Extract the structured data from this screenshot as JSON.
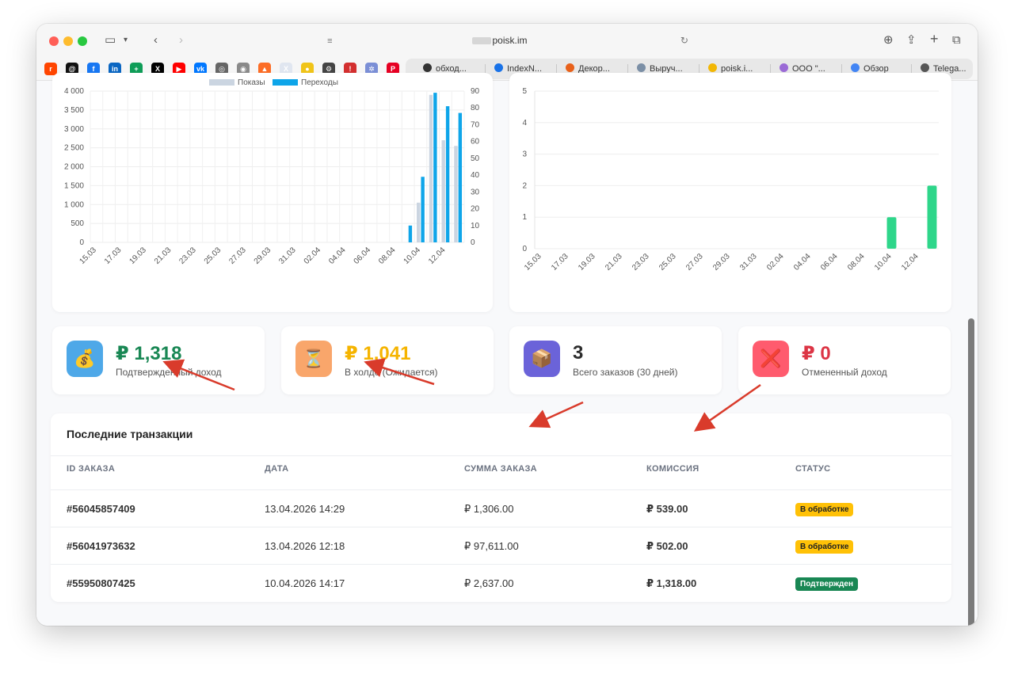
{
  "browser": {
    "url_domain": "poisk.im",
    "bookmark_tabs": [
      {
        "label": "обход...",
        "color": "#333333"
      },
      {
        "label": "IndexN...",
        "color": "#1a73e8"
      },
      {
        "label": "Декор...",
        "color": "#e8611a"
      },
      {
        "label": "Выруч...",
        "color": "#7b8fa6"
      },
      {
        "label": "poisk.i...",
        "color": "#f2b705"
      },
      {
        "label": "ООО \"...",
        "color": "#9b6bd6"
      },
      {
        "label": "Обзор",
        "color": "#4285f4"
      },
      {
        "label": "Telega...",
        "color": "#555555"
      }
    ],
    "favicons": [
      {
        "icon": "reddit-icon",
        "color": "#ff4500",
        "glyph": "r"
      },
      {
        "icon": "threads-icon",
        "color": "#111111",
        "glyph": "@"
      },
      {
        "icon": "facebook-icon",
        "color": "#1877f2",
        "glyph": "f"
      },
      {
        "icon": "linkedin-icon",
        "color": "#0a66c2",
        "glyph": "in"
      },
      {
        "icon": "sheets-icon",
        "color": "#0f9d58",
        "glyph": "+"
      },
      {
        "icon": "x-icon",
        "color": "#000000",
        "glyph": "X"
      },
      {
        "icon": "youtube-icon",
        "color": "#ff0000",
        "glyph": "▶"
      },
      {
        "icon": "vk-icon",
        "color": "#0077ff",
        "glyph": "vk"
      },
      {
        "icon": "globe-icon",
        "color": "#666666",
        "glyph": "◎"
      },
      {
        "icon": "compass-icon",
        "color": "#8a8a8a",
        "glyph": "◉"
      },
      {
        "icon": "gitlab-icon",
        "color": "#fc6d26",
        "glyph": "▲"
      },
      {
        "icon": "x-bookmark-icon",
        "color": "#e0e6f0",
        "glyph": "X"
      },
      {
        "icon": "bot-icon",
        "color": "#f0c419",
        "glyph": "●"
      },
      {
        "icon": "settings-icon",
        "color": "#444444",
        "glyph": "⚙"
      },
      {
        "icon": "alert-icon",
        "color": "#d32f2f",
        "glyph": "!"
      },
      {
        "icon": "network-icon",
        "color": "#7b8fd6",
        "glyph": "✲"
      },
      {
        "icon": "pinterest-icon",
        "color": "#e60023",
        "glyph": "P"
      }
    ]
  },
  "chart_data": [
    {
      "type": "bar",
      "legend": [
        "Показы",
        "Переходы"
      ],
      "categories": [
        "15.03",
        "16.03",
        "17.03",
        "18.03",
        "19.03",
        "20.03",
        "21.03",
        "22.03",
        "23.03",
        "24.03",
        "25.03",
        "26.03",
        "27.03",
        "28.03",
        "29.03",
        "30.03",
        "31.03",
        "01.04",
        "02.04",
        "03.04",
        "04.04",
        "05.04",
        "06.04",
        "07.04",
        "08.04",
        "09.04",
        "10.04",
        "11.04",
        "12.04",
        "13.04"
      ],
      "tick_labels": [
        "15.03",
        "17.03",
        "19.03",
        "21.03",
        "23.03",
        "25.03",
        "27.03",
        "29.03",
        "31.03",
        "02.04",
        "04.04",
        "06.04",
        "08.04",
        "10.04",
        "12.04"
      ],
      "series": [
        {
          "name": "Показы",
          "axis": "left",
          "color": "#cbd5e1",
          "values": [
            0,
            0,
            0,
            0,
            0,
            0,
            0,
            0,
            0,
            0,
            0,
            0,
            0,
            0,
            0,
            0,
            0,
            0,
            0,
            0,
            0,
            0,
            0,
            0,
            0,
            0,
            1050,
            3900,
            2700,
            2550
          ]
        },
        {
          "name": "Переходы",
          "axis": "right",
          "color": "#0ea5e9",
          "values": [
            0,
            0,
            0,
            0,
            0,
            0,
            0,
            0,
            0,
            0,
            0,
            0,
            0,
            0,
            0,
            0,
            0,
            0,
            0,
            0,
            0,
            0,
            0,
            0,
            0,
            10,
            39,
            89,
            81,
            77
          ]
        }
      ],
      "y_left": {
        "min": 0,
        "max": 4000,
        "ticks": [
          "0",
          "500",
          "1 000",
          "1 500",
          "2 000",
          "2 500",
          "3 000",
          "3 500",
          "4 000"
        ]
      },
      "y_right": {
        "min": 0,
        "max": 90,
        "ticks": [
          "0",
          "10",
          "20",
          "30",
          "40",
          "50",
          "60",
          "70",
          "80",
          "90"
        ]
      },
      "grid": true,
      "legend_position": "top"
    },
    {
      "type": "bar",
      "categories": [
        "15.03",
        "16.03",
        "17.03",
        "18.03",
        "19.03",
        "20.03",
        "21.03",
        "22.03",
        "23.03",
        "24.03",
        "25.03",
        "26.03",
        "27.03",
        "28.03",
        "29.03",
        "30.03",
        "31.03",
        "01.04",
        "02.04",
        "03.04",
        "04.04",
        "05.04",
        "06.04",
        "07.04",
        "08.04",
        "09.04",
        "10.04",
        "11.04",
        "12.04",
        "13.04"
      ],
      "tick_labels": [
        "15.03",
        "17.03",
        "19.03",
        "21.03",
        "23.03",
        "25.03",
        "27.03",
        "29.03",
        "31.03",
        "02.04",
        "04.04",
        "06.04",
        "08.04",
        "10.04",
        "12.04"
      ],
      "series": [
        {
          "color": "#2ed68a",
          "values": [
            0,
            0,
            0,
            0,
            0,
            0,
            0,
            0,
            0,
            0,
            0,
            0,
            0,
            0,
            0,
            0,
            0,
            0,
            0,
            0,
            0,
            0,
            0,
            0,
            0,
            0,
            1,
            0,
            0,
            2
          ]
        }
      ],
      "y": {
        "min": 0,
        "max": 5,
        "ticks": [
          "0",
          "1",
          "2",
          "3",
          "4",
          "5"
        ]
      },
      "grid": true
    }
  ],
  "stats": [
    {
      "value": "₽ 1,318",
      "label": "Подтвержденный доход",
      "icon": "money-bag-icon",
      "glyph": "💰",
      "value_color": "#198754",
      "icon_bg": "#4ea8e8"
    },
    {
      "value": "₽ 1,041",
      "label": "В холде (Ожидается)",
      "icon": "hourglass-icon",
      "glyph": "⏳",
      "value_color": "#f5b400",
      "icon_bg": "#f9a66b"
    },
    {
      "value": "3",
      "label": "Всего заказов (30 дней)",
      "icon": "package-icon",
      "glyph": "📦",
      "value_color": "#2d2d2d",
      "icon_bg": "#6b63d9"
    },
    {
      "value": "₽ 0",
      "label": "Отмененный доход",
      "icon": "cancel-icon",
      "glyph": "❌",
      "value_color": "#dc3545",
      "icon_bg": "#ff5b6e"
    }
  ],
  "transactions": {
    "title": "Последние транзакции",
    "headers": [
      "ID ЗАКАЗА",
      "ДАТА",
      "СУММА ЗАКАЗА",
      "КОМИССИЯ",
      "СТАТУС"
    ],
    "rows": [
      {
        "id": "#56045857409",
        "date": "13.04.2026 14:29",
        "amount": "₽ 1,306.00",
        "commission": "₽ 539.00",
        "status": "В обработке",
        "status_type": "warn"
      },
      {
        "id": "#56041973632",
        "date": "13.04.2026 12:18",
        "amount": "₽ 97,611.00",
        "commission": "₽ 502.00",
        "status": "В обработке",
        "status_type": "warn"
      },
      {
        "id": "#55950807425",
        "date": "10.04.2026 14:17",
        "amount": "₽ 2,637.00",
        "commission": "₽ 1,318.00",
        "status": "Подтвержден",
        "status_type": "ok"
      }
    ]
  }
}
